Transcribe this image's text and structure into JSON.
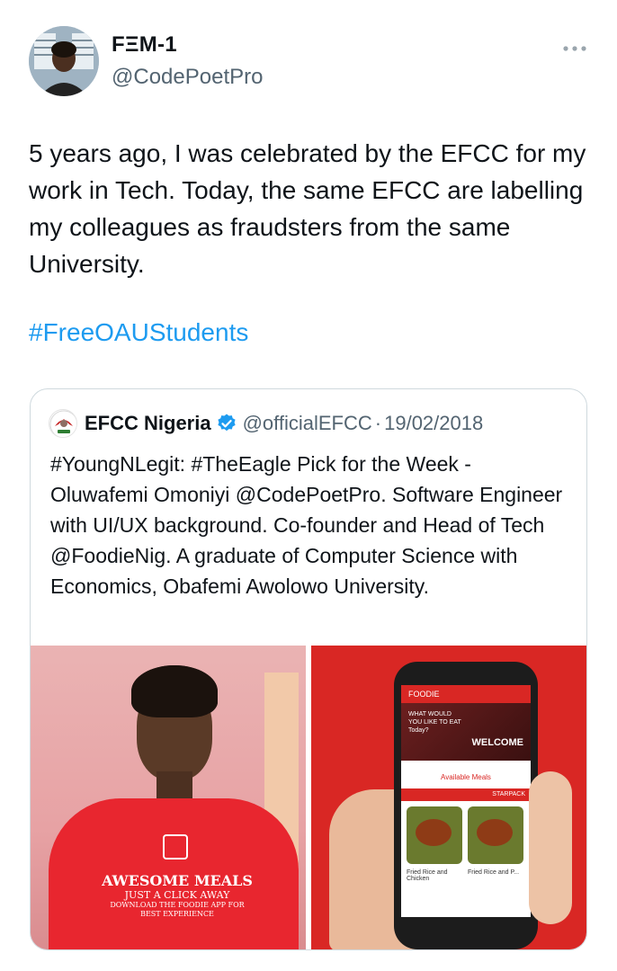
{
  "tweet": {
    "display_name": "FΞM-1",
    "handle": "@CodePoetPro",
    "more_icon": "more-options-icon",
    "text": "5 years ago, I was celebrated by the EFCC for my work in Tech. Today, the same EFCC are labelling my colleagues as fraudsters from the same University.",
    "hashtag": "#FreeOAUStudents"
  },
  "quoted": {
    "display_name": "EFCC Nigeria",
    "handle": "@officialEFCC",
    "separator": "·",
    "date": "19/02/2018",
    "verified_icon": "verified-badge-icon",
    "verified_color": "#1d9bf0",
    "text": "#YoungNLegit: #TheEagle Pick for the Week - Oluwafemi Omoniyi @CodePoetPro. Software Engineer with UI/UX background. Co-founder and Head of Tech @FoodieNig. A graduate of Computer Science with Economics, Obafemi Awolowo University.",
    "photo_left": {
      "shirt_line1": "AWESOME MEALS",
      "shirt_line2": "JUST A CLICK AWAY",
      "shirt_line3": "DOWNLOAD THE FOODIE APP FOR BEST EXPERIENCE"
    },
    "photo_right": {
      "app_title": "FOODIE",
      "hero_text": "WHAT WOULD YOU LIKE TO EAT Today?",
      "welcome": "WELCOME",
      "section": "Available Meals",
      "strip": "STARPACK",
      "food1": "Fried Rice and Chicken",
      "food2": "Fried Rice and P..."
    }
  },
  "colors": {
    "link": "#1d9bf0",
    "secondary_text": "#536471",
    "border": "#cfd9de",
    "brand_red": "#d92724"
  }
}
